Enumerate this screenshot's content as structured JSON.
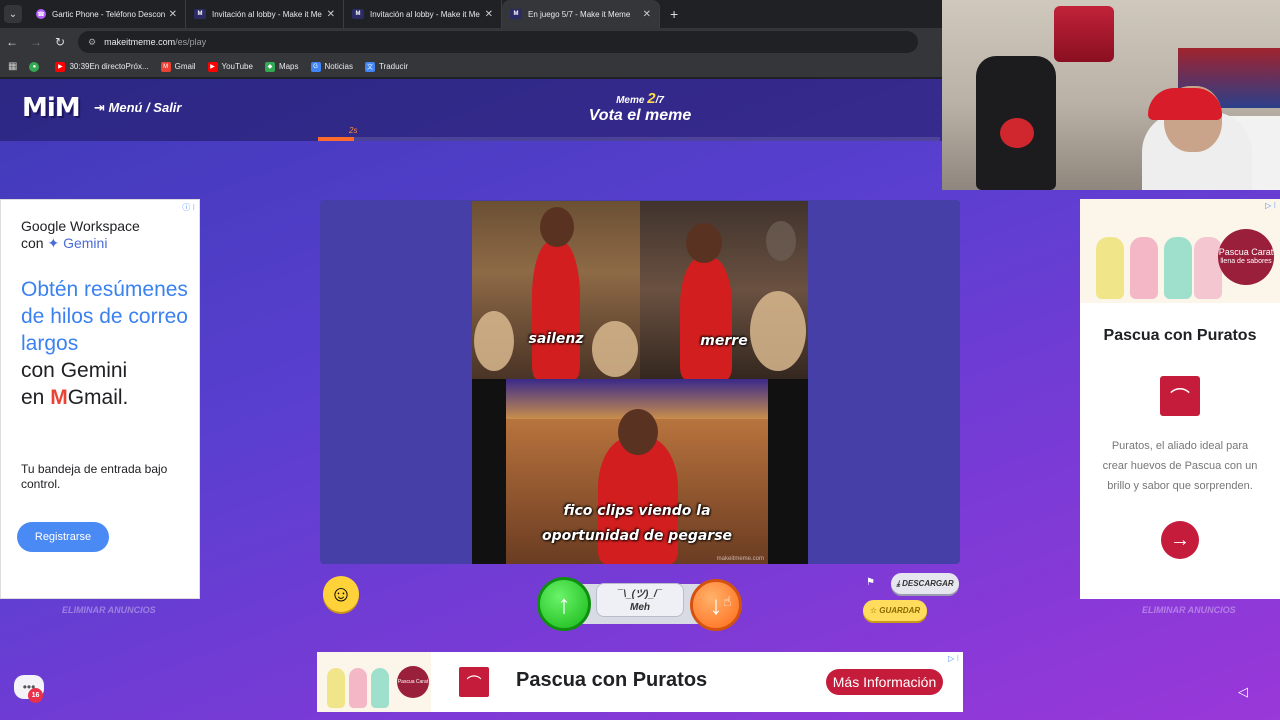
{
  "browser": {
    "tabs": [
      {
        "title": "Gartic Phone - Teléfono Descon",
        "favicon": "gartic"
      },
      {
        "title": "Invitación al lobby - Make it Me",
        "favicon": "mim"
      },
      {
        "title": "Invitación al lobby - Make it Me",
        "favicon": "mim"
      },
      {
        "title": "En juego 5/7 - Make it Meme",
        "favicon": "mim",
        "active": true
      }
    ],
    "url_domain": "makeitmeme.com",
    "url_path": "/es/play",
    "bookmarks": [
      {
        "label": "30:39En directoPróx..."
      },
      {
        "label": "Gmail"
      },
      {
        "label": "YouTube"
      },
      {
        "label": "Maps"
      },
      {
        "label": "Noticias"
      },
      {
        "label": "Traducir"
      }
    ]
  },
  "game": {
    "logo": "MiM",
    "menu_label": "Menú / Salir",
    "round_prefix": "Meme",
    "round_current": "2",
    "round_total": "/7",
    "phase": "Vota el meme",
    "timer_label": "2s",
    "timer_progress": 0.058
  },
  "meme": {
    "caption_tl": "sailenz",
    "caption_tr": "merre",
    "caption_bottom": "fico clips viendo la oportunidad de pegarse",
    "watermark": "makeitmeme.com"
  },
  "vote": {
    "up_icon": "arrow-up-icon",
    "meh_face": "¯\\_(ツ)_/¯",
    "meh_label": "Meh",
    "down_icon": "arrow-down-icon"
  },
  "actions": {
    "download_label": "DESCARGAR",
    "save_label": "GUARDAR"
  },
  "ads": {
    "remove_ads_label": "ELIMINAR ANUNCIOS",
    "left": {
      "title_line1": "Google Workspace",
      "title_line2_prefix": "con ",
      "title_line2_brand": "Gemini",
      "body_blue": "Obtén resúmenes de hilos de correo largos",
      "body_dark1": "con Gemini",
      "body_dark2_prefix": "en ",
      "body_dark2_brand": "Gmail.",
      "sub": "Tu bandeja de entrada bajo control.",
      "cta": "Registrarse"
    },
    "right": {
      "badge_title": "Pascua Carat",
      "badge_sub": "llena de sabores",
      "title": "Pascua con Puratos",
      "text": "Puratos, el aliado ideal para crear huevos de Pascua con un brillo y sabor que sorprenden."
    },
    "bottom": {
      "title": "Pascua con Puratos",
      "cta": "Más Información"
    }
  },
  "chat": {
    "badge": "16"
  },
  "colors": {
    "accent_orange": "#ff6b2c",
    "vote_up": "#17b817",
    "vote_down": "#ff6a1a",
    "puratos_red": "#c41c3a",
    "google_blue": "#4a8af4"
  }
}
